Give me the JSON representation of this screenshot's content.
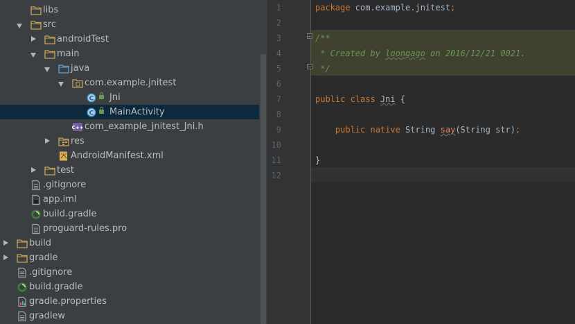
{
  "project_tree": {
    "rows": [
      {
        "label": "libs",
        "kind": "folder",
        "indent": 2,
        "arrow": "none"
      },
      {
        "label": "src",
        "kind": "folder",
        "indent": 2,
        "arrow": "open"
      },
      {
        "label": "androidTest",
        "kind": "folder",
        "indent": 3,
        "arrow": "closed"
      },
      {
        "label": "main",
        "kind": "folder",
        "indent": 3,
        "arrow": "open"
      },
      {
        "label": "java",
        "kind": "source-folder",
        "indent": 4,
        "arrow": "open"
      },
      {
        "label": "com.example.jnitest",
        "kind": "package",
        "indent": 5,
        "arrow": "open"
      },
      {
        "label": "Jni",
        "kind": "class",
        "indent": 6,
        "arrow": "none"
      },
      {
        "label": "MainActivity",
        "kind": "class",
        "indent": 6,
        "arrow": "none",
        "selected": true
      },
      {
        "label": "com_example_jnitest_Jni.h",
        "kind": "header",
        "indent": 5,
        "arrow": "none"
      },
      {
        "label": "res",
        "kind": "res-folder",
        "indent": 4,
        "arrow": "closed"
      },
      {
        "label": "AndroidManifest.xml",
        "kind": "manifest",
        "indent": 4,
        "arrow": "none"
      },
      {
        "label": "test",
        "kind": "folder",
        "indent": 3,
        "arrow": "closed"
      },
      {
        "label": ".gitignore",
        "kind": "file",
        "indent": 2,
        "arrow": "none"
      },
      {
        "label": "app.iml",
        "kind": "iml",
        "indent": 2,
        "arrow": "none"
      },
      {
        "label": "build.gradle",
        "kind": "gradle",
        "indent": 2,
        "arrow": "none"
      },
      {
        "label": "proguard-rules.pro",
        "kind": "file",
        "indent": 2,
        "arrow": "none"
      },
      {
        "label": "build",
        "kind": "folder",
        "indent": 1,
        "arrow": "closed"
      },
      {
        "label": "gradle",
        "kind": "folder",
        "indent": 1,
        "arrow": "closed"
      },
      {
        "label": ".gitignore",
        "kind": "file",
        "indent": 1,
        "arrow": "none"
      },
      {
        "label": "build.gradle",
        "kind": "gradle",
        "indent": 1,
        "arrow": "none"
      },
      {
        "label": "gradle.properties",
        "kind": "properties",
        "indent": 1,
        "arrow": "none"
      },
      {
        "label": "gradlew",
        "kind": "file",
        "indent": 1,
        "arrow": "none"
      }
    ]
  },
  "editor": {
    "line_numbers": [
      "1",
      "2",
      "3",
      "4",
      "5",
      "6",
      "7",
      "8",
      "9",
      "10",
      "11",
      "12"
    ],
    "lines": [
      {
        "tokens": [
          {
            "t": "package ",
            "c": "kw"
          },
          {
            "t": "com.example.jnitest",
            "c": "txt"
          },
          {
            "t": ";",
            "c": "kw"
          }
        ]
      },
      {
        "tokens": []
      },
      {
        "tokens": [
          {
            "t": "/**",
            "c": "cmt"
          }
        ]
      },
      {
        "tokens": [
          {
            "t": " * Created by ",
            "c": "cmt"
          },
          {
            "t": "loongago",
            "c": "cmt-u"
          },
          {
            "t": " on 2016/12/21 0021.",
            "c": "cmt"
          }
        ]
      },
      {
        "tokens": [
          {
            "t": " */",
            "c": "cmt"
          }
        ]
      },
      {
        "tokens": []
      },
      {
        "tokens": [
          {
            "t": "public class ",
            "c": "kw"
          },
          {
            "t": "Jni",
            "c": "ref"
          },
          {
            "t": " {",
            "c": "txt"
          }
        ]
      },
      {
        "tokens": []
      },
      {
        "tokens": [
          {
            "t": "    public native ",
            "c": "kw"
          },
          {
            "t": "String ",
            "c": "txt"
          },
          {
            "t": "say",
            "c": "method"
          },
          {
            "t": "(String str)",
            "c": "txt"
          },
          {
            "t": ";",
            "c": "kw"
          }
        ]
      },
      {
        "tokens": []
      },
      {
        "tokens": [
          {
            "t": "}",
            "c": "txt"
          }
        ]
      },
      {
        "tokens": []
      }
    ]
  },
  "colors": {
    "panel_bg": "#3c3f41",
    "editor_bg": "#2b2b2b",
    "selection": "#0d293e",
    "folder": "#c9a55b",
    "class_icon": "#5ea5d6"
  }
}
